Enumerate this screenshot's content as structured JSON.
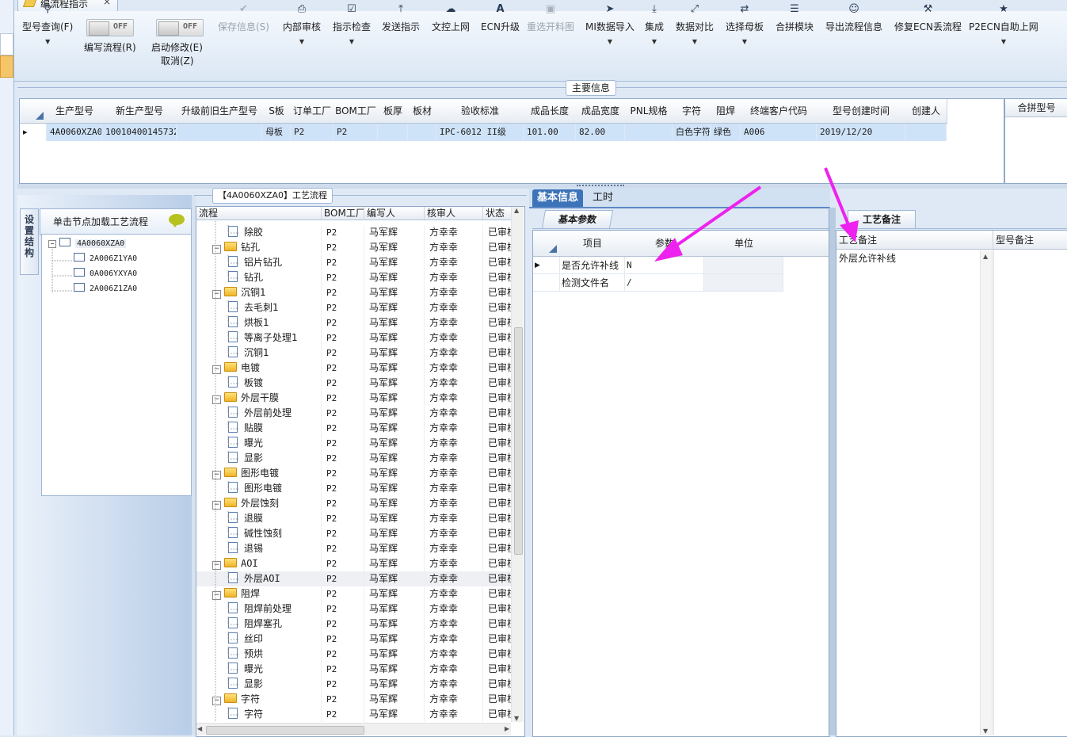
{
  "window": {
    "doc_tab_label": "编流程指示",
    "doc_tab_close": "×"
  },
  "toolbar": {
    "query": {
      "label": "型号查询(F)",
      "icon": "search-icon"
    },
    "write_flow": {
      "toggle": "OFF",
      "label": "编写流程(R)"
    },
    "start_modify": {
      "toggle": "OFF",
      "label": "启动修改(E)",
      "label2": "取消(Z)"
    },
    "save_info": {
      "label": "保存信息(S)",
      "icon": "check-icon",
      "disabled": true
    },
    "internal_review": {
      "label": "内部审核",
      "icon": "printer-icon"
    },
    "instruction_check": {
      "label": "指示检查",
      "icon": "checkbox-icon"
    },
    "send_instruction": {
      "label": "发送指示",
      "icon": "upload-icon"
    },
    "upload_doc": {
      "label": "文控上网",
      "icon": "cloud-upload-icon"
    },
    "ecn_upgrade": {
      "label": "ECN升级",
      "icon": "font-icon"
    },
    "reselect_cut": {
      "label": "重选开料图",
      "icon": "image-icon",
      "disabled": true
    },
    "mi_import": {
      "label": "MI数据导入",
      "icon": "import-icon"
    },
    "integrate": {
      "label": "集成",
      "icon": "download-icon"
    },
    "data_compare": {
      "label": "数据对比",
      "icon": "compress-icon"
    },
    "select_mother": {
      "label": "选择母板",
      "icon": "shuffle-icon"
    },
    "merge_module": {
      "label": "合拼模块",
      "icon": "list-icon"
    },
    "export_flow": {
      "label": "导出流程信息",
      "icon": "smile-icon"
    },
    "fix_ecn": {
      "label": "修复ECN丢流程",
      "icon": "wrench-icon"
    },
    "p2ecn": {
      "label": "P2ECN自助上网",
      "icon": "star-icon"
    }
  },
  "main_info": {
    "caption": "主要信息",
    "columns": [
      "生产型号",
      "新生产型号",
      "升级前旧生产型号",
      "S板",
      "订单工厂",
      "BOM工厂",
      "板厚",
      "板材",
      "验收标准",
      "成品长度",
      "成品宽度",
      "PNL规格",
      "字符",
      "阻焊",
      "终端客户代码",
      "型号创建时间",
      "创建人"
    ],
    "row": [
      "4A0060XZA0",
      "10010400145732",
      "",
      "母板",
      "P2",
      "P2",
      "",
      "",
      "IPC-6012 II级",
      "101.00",
      "82.00",
      "",
      "白色字符",
      "绿色",
      "A006",
      "2019/12/20",
      ""
    ],
    "merge_header": "合拼型号"
  },
  "left_panel": {
    "vertical_tab": "设置结构",
    "header": "单击节点加载工艺流程",
    "tree": {
      "root": "4A0060XZA0",
      "children": [
        "2A006Z1YA0",
        "0A006YXYA0",
        "2A006Z1ZA0"
      ]
    }
  },
  "process": {
    "caption": "【4A0060XZA0】工艺流程",
    "columns": [
      "流程",
      "BOM工厂",
      "编写人",
      "核审人",
      "状态"
    ],
    "rows": [
      {
        "name": "除胶",
        "level": 2,
        "factory": "P2",
        "writer": "马军辉",
        "reviewer": "方幸幸",
        "status": "已审核"
      },
      {
        "name": "钻孔",
        "level": 1,
        "factory": "P2",
        "writer": "马军辉",
        "reviewer": "方幸幸",
        "status": "已审核"
      },
      {
        "name": "铝片钻孔",
        "level": 2,
        "factory": "P2",
        "writer": "马军辉",
        "reviewer": "方幸幸",
        "status": "已审核"
      },
      {
        "name": "钻孔",
        "level": 2,
        "factory": "P2",
        "writer": "马军辉",
        "reviewer": "方幸幸",
        "status": "已审核"
      },
      {
        "name": "沉铜1",
        "level": 1,
        "factory": "P2",
        "writer": "马军辉",
        "reviewer": "方幸幸",
        "status": "已审核"
      },
      {
        "name": "去毛刺1",
        "level": 2,
        "factory": "P2",
        "writer": "马军辉",
        "reviewer": "方幸幸",
        "status": "已审核"
      },
      {
        "name": "烘板1",
        "level": 2,
        "factory": "P2",
        "writer": "马军辉",
        "reviewer": "方幸幸",
        "status": "已审核"
      },
      {
        "name": "等离子处理1",
        "level": 2,
        "factory": "P2",
        "writer": "马军辉",
        "reviewer": "方幸幸",
        "status": "已审核"
      },
      {
        "name": "沉铜1",
        "level": 2,
        "factory": "P2",
        "writer": "马军辉",
        "reviewer": "方幸幸",
        "status": "已审核"
      },
      {
        "name": "电镀",
        "level": 1,
        "factory": "P2",
        "writer": "马军辉",
        "reviewer": "方幸幸",
        "status": "已审核"
      },
      {
        "name": "板镀",
        "level": 2,
        "factory": "P2",
        "writer": "马军辉",
        "reviewer": "方幸幸",
        "status": "已审核"
      },
      {
        "name": "外层干膜",
        "level": 1,
        "factory": "P2",
        "writer": "马军辉",
        "reviewer": "方幸幸",
        "status": "已审核"
      },
      {
        "name": "外层前处理",
        "level": 2,
        "factory": "P2",
        "writer": "马军辉",
        "reviewer": "方幸幸",
        "status": "已审核"
      },
      {
        "name": "贴膜",
        "level": 2,
        "factory": "P2",
        "writer": "马军辉",
        "reviewer": "方幸幸",
        "status": "已审核"
      },
      {
        "name": "曝光",
        "level": 2,
        "factory": "P2",
        "writer": "马军辉",
        "reviewer": "方幸幸",
        "status": "已审核"
      },
      {
        "name": "显影",
        "level": 2,
        "factory": "P2",
        "writer": "马军辉",
        "reviewer": "方幸幸",
        "status": "已审核"
      },
      {
        "name": "图形电镀",
        "level": 1,
        "factory": "P2",
        "writer": "马军辉",
        "reviewer": "方幸幸",
        "status": "已审核"
      },
      {
        "name": "图形电镀",
        "level": 2,
        "factory": "P2",
        "writer": "马军辉",
        "reviewer": "方幸幸",
        "status": "已审核"
      },
      {
        "name": "外层蚀刻",
        "level": 1,
        "factory": "P2",
        "writer": "马军辉",
        "reviewer": "方幸幸",
        "status": "已审核"
      },
      {
        "name": "退膜",
        "level": 2,
        "factory": "P2",
        "writer": "马军辉",
        "reviewer": "方幸幸",
        "status": "已审核"
      },
      {
        "name": "碱性蚀刻",
        "level": 2,
        "factory": "P2",
        "writer": "马军辉",
        "reviewer": "方幸幸",
        "status": "已审核"
      },
      {
        "name": "退锡",
        "level": 2,
        "factory": "P2",
        "writer": "马军辉",
        "reviewer": "方幸幸",
        "status": "已审核"
      },
      {
        "name": "AOI",
        "level": 1,
        "factory": "P2",
        "writer": "马军辉",
        "reviewer": "方幸幸",
        "status": "已审核"
      },
      {
        "name": "外层AOI",
        "level": 2,
        "factory": "P2",
        "writer": "马军辉",
        "reviewer": "方幸幸",
        "status": "已审核",
        "selected": true
      },
      {
        "name": "阻焊",
        "level": 1,
        "factory": "P2",
        "writer": "马军辉",
        "reviewer": "方幸幸",
        "status": "已审核"
      },
      {
        "name": "阻焊前处理",
        "level": 2,
        "factory": "P2",
        "writer": "马军辉",
        "reviewer": "方幸幸",
        "status": "已审核"
      },
      {
        "name": "阻焊塞孔",
        "level": 2,
        "factory": "P2",
        "writer": "马军辉",
        "reviewer": "方幸幸",
        "status": "已审核"
      },
      {
        "name": "丝印",
        "level": 2,
        "factory": "P2",
        "writer": "马军辉",
        "reviewer": "方幸幸",
        "status": "已审核"
      },
      {
        "name": "预烘",
        "level": 2,
        "factory": "P2",
        "writer": "马军辉",
        "reviewer": "方幸幸",
        "status": "已审核"
      },
      {
        "name": "曝光",
        "level": 2,
        "factory": "P2",
        "writer": "马军辉",
        "reviewer": "方幸幸",
        "status": "已审核"
      },
      {
        "name": "显影",
        "level": 2,
        "factory": "P2",
        "writer": "马军辉",
        "reviewer": "方幸幸",
        "status": "已审核"
      },
      {
        "name": "字符",
        "level": 1,
        "factory": "P2",
        "writer": "马军辉",
        "reviewer": "方幸幸",
        "status": "已审核"
      },
      {
        "name": "字符",
        "level": 2,
        "factory": "P2",
        "writer": "马军辉",
        "reviewer": "方幸幸",
        "status": "已审核"
      }
    ]
  },
  "detail_tabs": {
    "tab_basic": "基本信息",
    "tab_hours": "工时",
    "basic_params_tab": "基本参数",
    "columns": [
      "项目",
      "参数",
      "单位"
    ],
    "rows": [
      {
        "item": "是否允许补线",
        "param": "N",
        "unit": ""
      },
      {
        "item": "检测文件名",
        "param": "/",
        "unit": ""
      }
    ]
  },
  "remarks": {
    "tab": "工艺备注",
    "col_process": "工艺备注",
    "col_model": "型号备注",
    "process_remark": "外层允许补线"
  },
  "annotation_color": "#ee22ee"
}
